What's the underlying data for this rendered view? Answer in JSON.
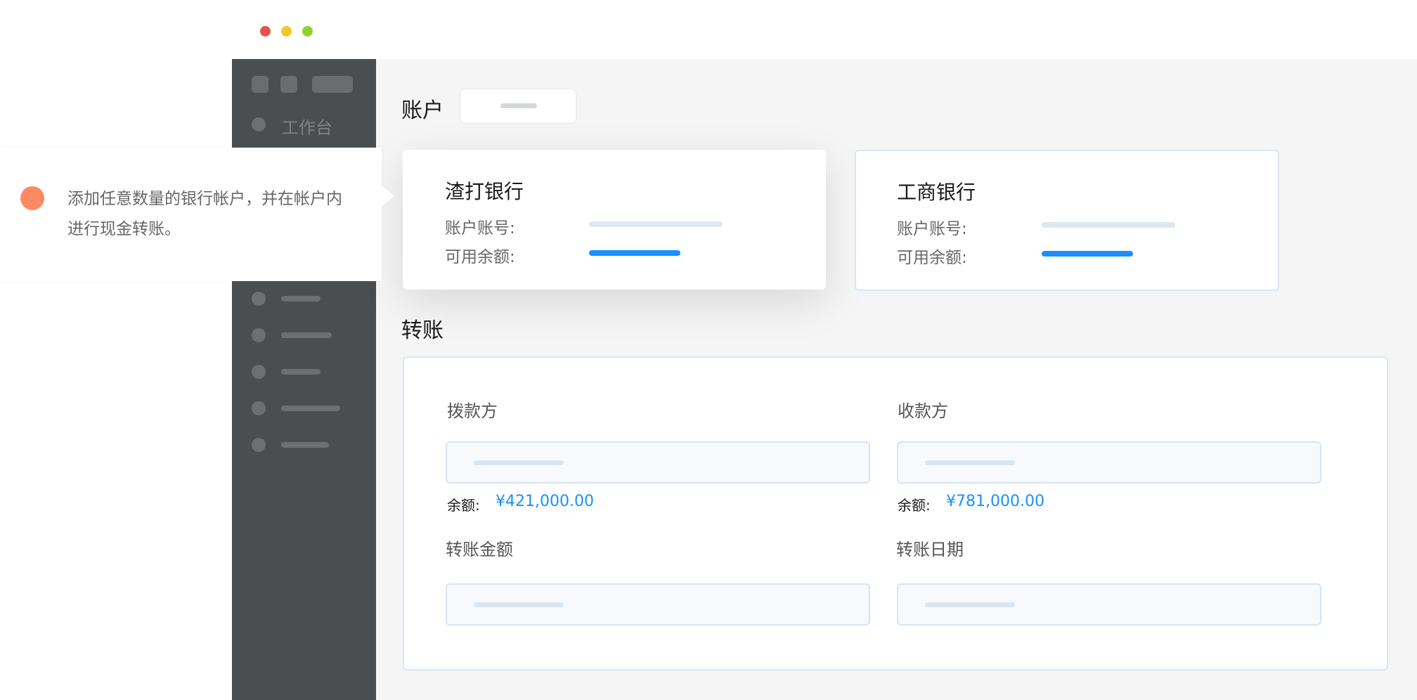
{
  "window": {
    "controls": [
      {
        "name": "close",
        "color": "#e5534b"
      },
      {
        "name": "minimize",
        "color": "#f7c52a"
      },
      {
        "name": "maximize",
        "color": "#8fd12f"
      }
    ]
  },
  "sidebar": {
    "workspace_label": "工作台",
    "bg_color": "#4b4e51"
  },
  "callout": {
    "text": "添加任意数量的银行帐户，并在帐户内进行现金转账。",
    "dot_color": "#ff8a62"
  },
  "accounts": {
    "title": "账户",
    "cards": [
      {
        "bank": "渣打银行",
        "account_no_label": "账户账号:",
        "available_label": "可用余额:"
      },
      {
        "bank": "工商银行",
        "account_no_label": "账户账号:",
        "available_label": "可用余额:"
      }
    ]
  },
  "transfer": {
    "title": "转账",
    "payer_label": "拨款方",
    "payee_label": "收款方",
    "payer_balance_label": "余额:",
    "payer_balance": "¥421,000.00",
    "payee_balance_label": "余额:",
    "payee_balance": "¥781,000.00",
    "amount_label": "转账金额",
    "date_label": "转账日期"
  },
  "colors": {
    "accent": "#1890ff",
    "page_bg": "#f5f5f5"
  }
}
